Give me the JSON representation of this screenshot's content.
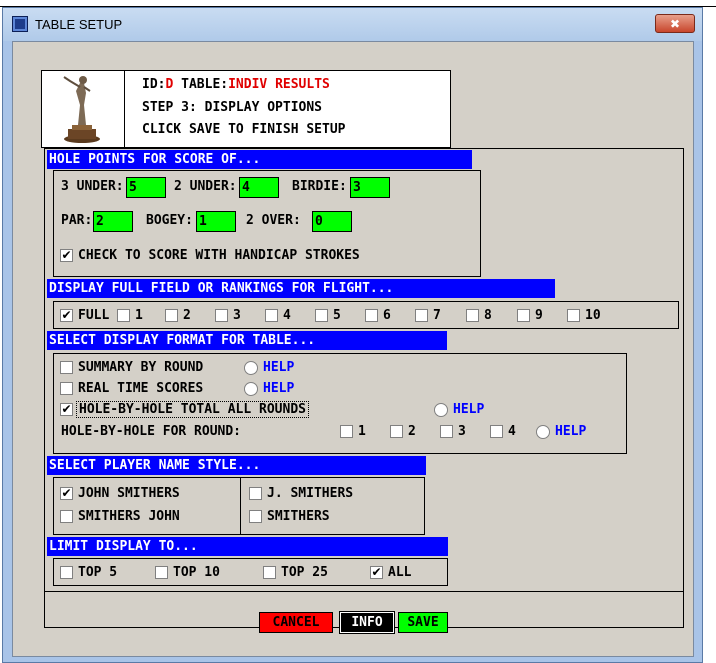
{
  "window": {
    "title": "TABLE SETUP",
    "close_glyph": "✖"
  },
  "info": {
    "id_label": "ID:",
    "id_value": "D",
    "table_label": "TABLE:",
    "table_value": "INDIV RESULTS",
    "step": "STEP 3: DISPLAY OPTIONS",
    "instruction": "CLICK SAVE TO FINISH SETUP"
  },
  "hole_points": {
    "header": "HOLE POINTS FOR SCORE OF...",
    "three_under_label": "3 UNDER:",
    "three_under_value": "5",
    "two_under_label": "2 UNDER:",
    "two_under_value": "4",
    "birdie_label": "BIRDIE:",
    "birdie_value": "3",
    "par_label": "PAR:",
    "par_value": "2",
    "bogey_label": "BOGEY:",
    "bogey_value": "1",
    "two_over_label": "2 OVER:",
    "two_over_value": "0",
    "handicap_label": "CHECK TO SCORE WITH HANDICAP STROKES",
    "handicap_checked": true
  },
  "flight": {
    "header": "DISPLAY FULL FIELD OR RANKINGS FOR FLIGHT...",
    "options": [
      "FULL",
      "1",
      "2",
      "3",
      "4",
      "5",
      "6",
      "7",
      "8",
      "9",
      "10"
    ],
    "selected": "FULL"
  },
  "format": {
    "header": "SELECT DISPLAY FORMAT FOR TABLE...",
    "summary_label": "SUMMARY BY ROUND",
    "realtime_label": "REAL TIME SCORES",
    "hbh_total_label": "HOLE-BY-HOLE TOTAL ALL ROUNDS",
    "hbh_round_label": "HOLE-BY-HOLE FOR ROUND:",
    "rounds": [
      "1",
      "2",
      "3",
      "4"
    ],
    "help_label": "HELP",
    "selected": "HOLE-BY-HOLE TOTAL ALL ROUNDS"
  },
  "name_style": {
    "header": "SELECT PLAYER NAME STYLE...",
    "options": [
      "JOHN SMITHERS",
      "J. SMITHERS",
      "SMITHERS JOHN",
      "SMITHERS"
    ],
    "selected": "JOHN SMITHERS"
  },
  "limit": {
    "header": "LIMIT DISPLAY TO...",
    "options": [
      "TOP 5",
      "TOP 10",
      "TOP 25",
      "ALL"
    ],
    "selected": "ALL"
  },
  "buttons": {
    "cancel": "CANCEL",
    "info": "INFO",
    "save": "SAVE"
  },
  "check_glyph": "✔",
  "colors": {
    "header_bg": "#0000ff",
    "value_bg": "#00ff00",
    "cancel_bg": "#ff0000",
    "accent_red": "#e00000",
    "help": "#0000ff"
  }
}
